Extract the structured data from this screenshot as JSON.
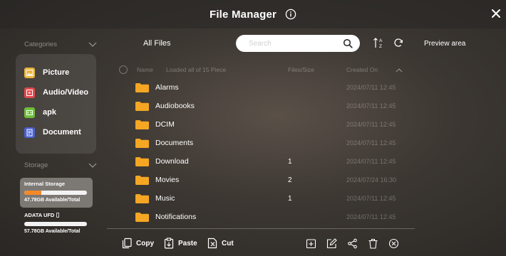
{
  "window": {
    "title": "File Manager"
  },
  "sidebar": {
    "categories_label": "Categories",
    "categories": [
      {
        "label": "Picture",
        "icon": "picture-icon",
        "color": "#e8b43a"
      },
      {
        "label": "Audio/Video",
        "icon": "audio-video-icon",
        "color": "#e5484d"
      },
      {
        "label": "apk",
        "icon": "apk-icon",
        "color": "#6fbf3a"
      },
      {
        "label": "Document",
        "icon": "document-icon",
        "color": "#4a5fd0"
      }
    ],
    "storage_label": "Storage",
    "storage": [
      {
        "name": "Internal Storage",
        "available": "47.78GB Available/Total",
        "used_fraction": 0.27,
        "selected": true
      },
      {
        "name": "ADATA UFD",
        "available": "57.78GB Available/Total",
        "used_fraction": 0.0,
        "selected": false
      }
    ]
  },
  "main": {
    "breadcrumb": "All Files",
    "search_placeholder": "Search",
    "preview_label": "Preview area",
    "columns": {
      "name": "Name",
      "loaded": "Loaded all of 15 Piece",
      "size": "Files/Size",
      "date": "Created On"
    },
    "files": [
      {
        "name": "Alarms",
        "size": "",
        "date": "2024/07/11 12:45"
      },
      {
        "name": "Audiobooks",
        "size": "",
        "date": "2024/07/11 12:45"
      },
      {
        "name": "DCIM",
        "size": "",
        "date": "2024/07/11 12:45"
      },
      {
        "name": "Documents",
        "size": "",
        "date": "2024/07/11 12:45"
      },
      {
        "name": "Download",
        "size": "1",
        "date": "2024/07/11 12:45"
      },
      {
        "name": "Movies",
        "size": "2",
        "date": "2024/07/24 16:30"
      },
      {
        "name": "Music",
        "size": "1",
        "date": "2024/07/11 12:45"
      },
      {
        "name": "Notifications",
        "size": "",
        "date": "2024/07/11 12:45"
      }
    ]
  },
  "toolbar": {
    "copy": "Copy",
    "paste": "Paste",
    "cut": "Cut"
  },
  "colors": {
    "accent": "#f28a2a",
    "folder": "#f5a623"
  }
}
